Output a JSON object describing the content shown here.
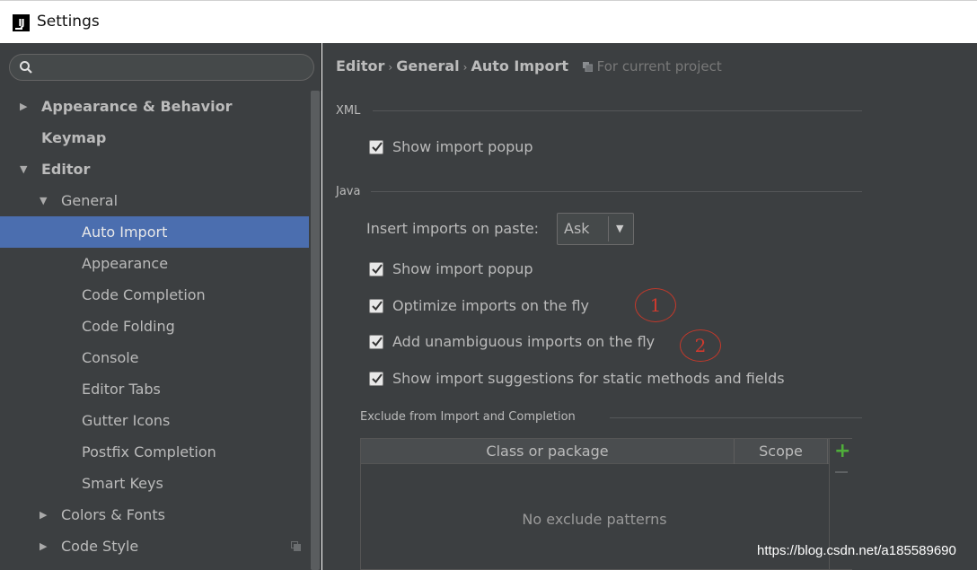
{
  "window": {
    "title": "Settings",
    "app_icon_text": "IJ"
  },
  "search": {
    "value": "",
    "placeholder": ""
  },
  "sidebar": {
    "items": [
      {
        "label": "Appearance & Behavior",
        "arrow": "▶"
      },
      {
        "label": "Keymap"
      },
      {
        "label": "Editor",
        "arrow": "▼"
      },
      {
        "label": "General",
        "arrow": "▼"
      },
      {
        "label": "Auto Import"
      },
      {
        "label": "Appearance"
      },
      {
        "label": "Code Completion"
      },
      {
        "label": "Code Folding"
      },
      {
        "label": "Console"
      },
      {
        "label": "Editor Tabs"
      },
      {
        "label": "Gutter Icons"
      },
      {
        "label": "Postfix Completion"
      },
      {
        "label": "Smart Keys"
      },
      {
        "label": "Colors & Fonts",
        "arrow": "▶"
      },
      {
        "label": "Code Style",
        "arrow": "▶"
      }
    ]
  },
  "breadcrumb": {
    "items": [
      "Editor",
      "General",
      "Auto Import"
    ],
    "separator": "›",
    "project_hint": "For current project"
  },
  "xml": {
    "title": "XML",
    "show_import_popup": {
      "label": "Show import popup",
      "checked": true
    }
  },
  "java": {
    "title": "Java",
    "paste_label": "Insert imports on paste:",
    "paste_value": "Ask",
    "combo_arrow": "▼",
    "options": [
      {
        "label": "Show import popup",
        "checked": true
      },
      {
        "label": "Optimize imports on the fly",
        "checked": true
      },
      {
        "label": "Add unambiguous imports on the fly",
        "checked": true
      },
      {
        "label": "Show import suggestions for static methods and fields",
        "checked": true
      }
    ]
  },
  "annotations": [
    "1",
    "2"
  ],
  "exclude": {
    "title": "Exclude from Import and Completion",
    "columns": [
      "Class or package",
      "Scope"
    ],
    "empty_text": "No exclude patterns",
    "add_label": "+"
  },
  "watermark": "https://blog.csdn.net/a185589690",
  "colors": {
    "panel": "#3c3f41",
    "selection": "#4b6eaf",
    "text": "#bbbbbb",
    "annotation": "#c0392b",
    "add": "#4fae3a"
  }
}
